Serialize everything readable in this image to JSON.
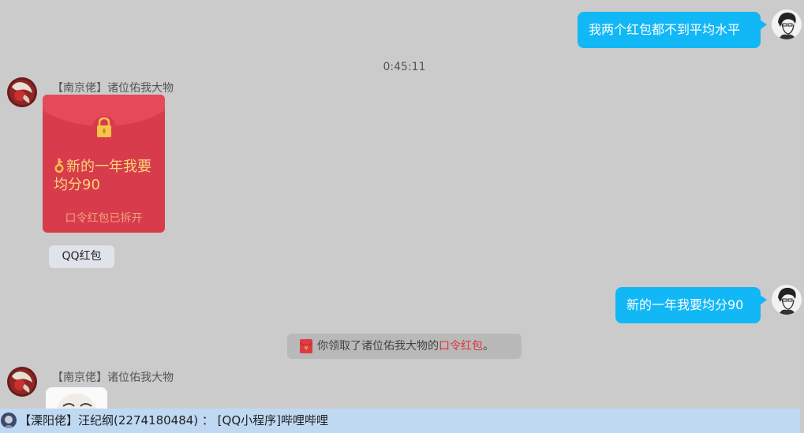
{
  "messages": {
    "msg1_text": "我两个红包都不到平均水平",
    "timestamp": "0:45:11",
    "sender1": "【南京佬】诸位佑我大物",
    "redpacket": {
      "title": "新的一年我要均分90",
      "status": "口令红包已拆开",
      "tag": "QQ红包"
    },
    "msg2_text": "新的一年我要均分90",
    "system_note": {
      "prefix": "你领取了诸位佑我大物的",
      "highlight": "口令红包",
      "suffix": "。"
    },
    "sender2": "【南京佬】诸位佑我大物"
  },
  "notification": {
    "text": "【溧阳佬】汪纪纲(2274180484) ： [QQ小程序]哔哩哔哩"
  },
  "colors": {
    "bubble": "#12b7f5",
    "redpacket": "#d83c4c",
    "background": "#cbcbcb",
    "notification_bar": "#bfd9f3",
    "highlight": "#e0303a"
  },
  "icons": [
    "avatar-self",
    "avatar-nanjing",
    "lock-icon",
    "key-icon",
    "red-envelope-icon",
    "avatar-liyang"
  ]
}
